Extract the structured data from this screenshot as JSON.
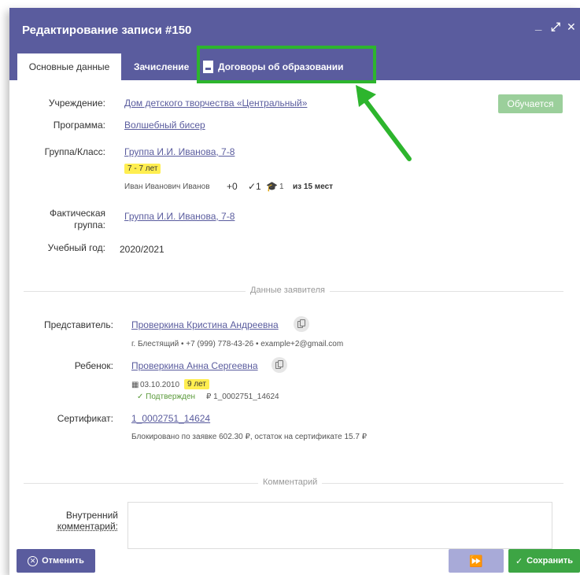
{
  "window": {
    "title": "Редактирование записи #150",
    "controls": {
      "minimize": "_",
      "maximize": "⤢",
      "close": "✕"
    }
  },
  "tabs": [
    {
      "label": "Основные данные",
      "active": true
    },
    {
      "label": "Зачисление",
      "active": false
    },
    {
      "label": "Договоры об образовании",
      "active": false,
      "icon": "pdf-file-icon"
    }
  ],
  "main": {
    "institution_label": "Учреждение:",
    "institution": "Дом детского творчества «Центральный»",
    "status": "Обучается",
    "program_label": "Программа:",
    "program": "Волшебный бисер",
    "group_label": "Группа/Класс:",
    "group": "Группа И.И. Иванова, 7-8",
    "age_badge": "7 - 7 лет",
    "teacher": "Иван Иванович Иванов",
    "count_plus": "+0",
    "count_check": "✓1",
    "count_grad": "1",
    "places": "из 15 мест",
    "actual_group_label_1": "Фактическая",
    "actual_group_label_2": "группа:",
    "actual_group": "Группа И.И. Иванова, 7-8",
    "year_label": "Учебный год:",
    "year": "2020/2021"
  },
  "applicant": {
    "section_title": "Данные заявителя",
    "rep_label": "Представитель:",
    "rep": "Проверкина Кристина Андреевна",
    "rep_info": "г. Блестящий • +7 (999) 778-43-26 • example+2@gmail.com",
    "child_label": "Ребенок:",
    "child": "Проверкина Анна Сергеевна",
    "child_dob": "03.10.2010",
    "child_age": "9 лет",
    "child_status": "✓ Подтвержден",
    "child_cert": "₽ 1_0002751_14624",
    "cert_label": "Сертификат:",
    "cert": "1_0002751_14624",
    "cert_info": "Блокировано по заявке 602.30 ₽, остаток на сертификате 15.7 ₽"
  },
  "comment": {
    "section_title": "Комментарий",
    "internal_label_1": "Внутренний",
    "internal_label_2": "комментарий:"
  },
  "footer": {
    "cancel": "Отменить",
    "next": "⏩",
    "save": "Сохранить"
  },
  "colors": {
    "header": "#5a5c9e",
    "highlight": "#2db52d",
    "status": "#9bcf9b",
    "save": "#3da544"
  }
}
